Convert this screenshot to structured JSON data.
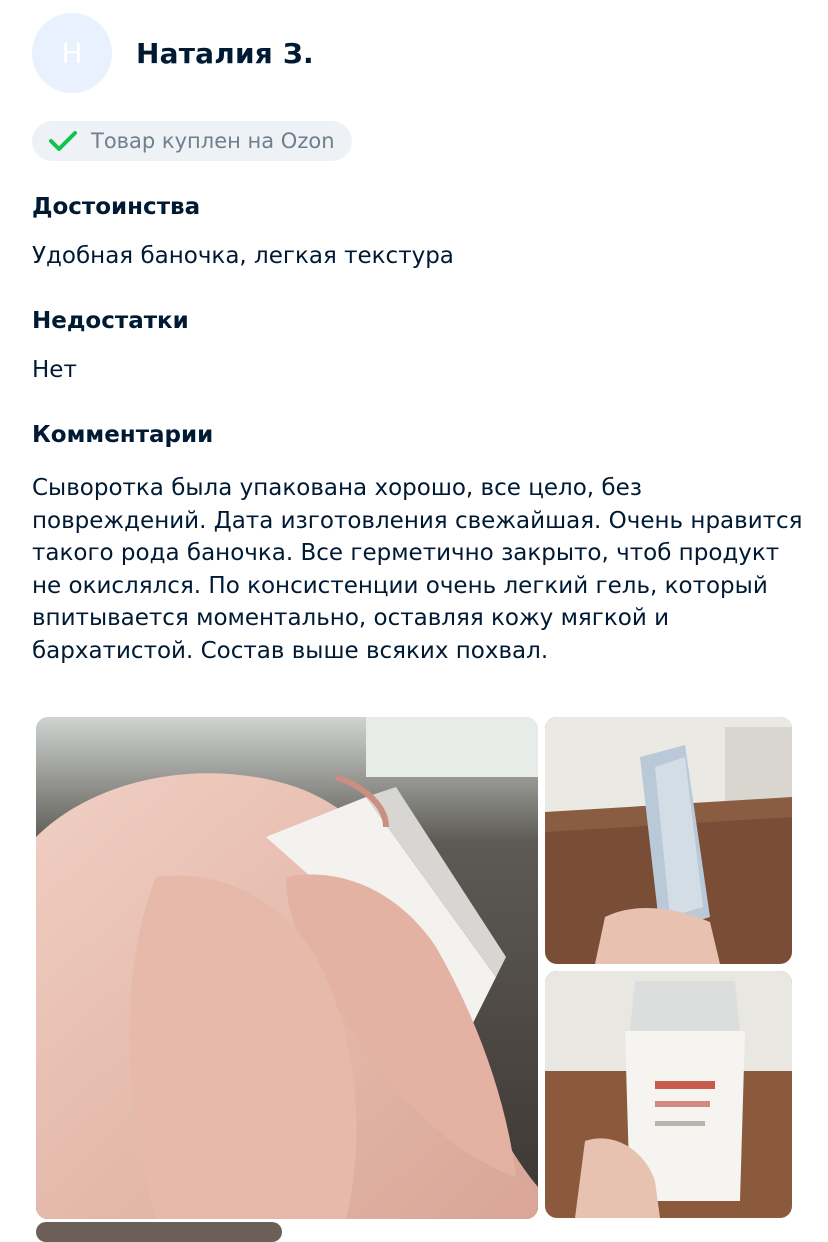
{
  "review": {
    "avatar_letter": "Н",
    "author": "Наталия З.",
    "badge": "Товар куплен на Ozon",
    "advantages_title": "Достоинства",
    "advantages_text": "Удобная баночка, легкая текстура",
    "disadvantages_title": "Недостатки",
    "disadvantages_text": "Нет",
    "comment_title": "Комментарии",
    "comment_text": "Сыворотка была упакована хорошо, все цело, без повреждений. Дата изготовления свежайшая. Очень нравится такого рода баночка. Все герметично закрыто, чтоб продукт не окислялся. По консистенции очень легкий гель, который впитывается моментально, оставляя кожу мягкой и бархатистой. Состав выше всяких похвал."
  },
  "colors": {
    "text": "#001a34",
    "muted": "#707f8d",
    "badge_bg": "#eef1f5",
    "check": "#10c44c",
    "avatar_bg": "#e8f1fd"
  }
}
